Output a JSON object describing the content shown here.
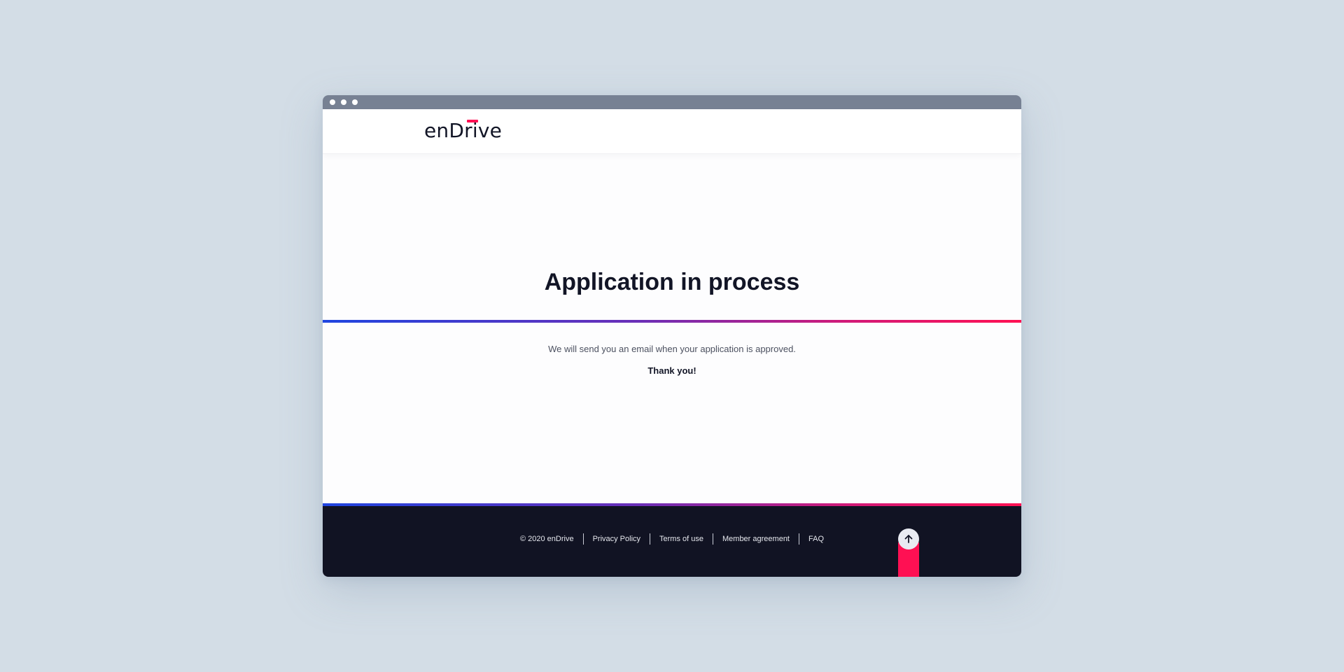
{
  "header": {
    "logo_text": "enDrive"
  },
  "main": {
    "title": "Application in process",
    "message": "We will send you an email when your application is approved.",
    "thanks": "Thank you!"
  },
  "footer": {
    "copyright": "© 2020 enDrive",
    "links": [
      "Privacy Policy",
      "Terms of use",
      "Member agreement",
      "FAQ"
    ]
  },
  "icons": {
    "scroll_top": "arrow-up-icon"
  },
  "colors": {
    "accent": "#ff1053",
    "dark": "#111323",
    "gradient_start": "#1f45e0",
    "gradient_end": "#ff1153"
  }
}
